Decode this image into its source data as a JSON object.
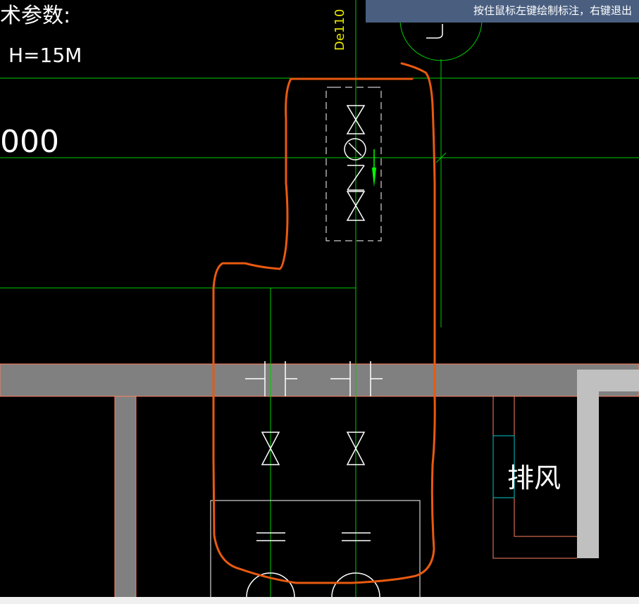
{
  "status_tip": "按住鼠标左键绘制标注，右键退出",
  "labels": {
    "params": "术参数:",
    "head": "H=15M",
    "numbers": "000",
    "pipe_size": "De110",
    "exhaust": "排风"
  },
  "colors": {
    "background": "#000000",
    "green_line": "#00cc00",
    "white_line": "#ffffff",
    "orange_markup": "#e85a10",
    "wall_gray": "#808080",
    "wall_light": "#c0c0c0",
    "cyan": "#00c8c8",
    "pink_edge": "#ff8060",
    "yellow_text": "#e6e600"
  }
}
